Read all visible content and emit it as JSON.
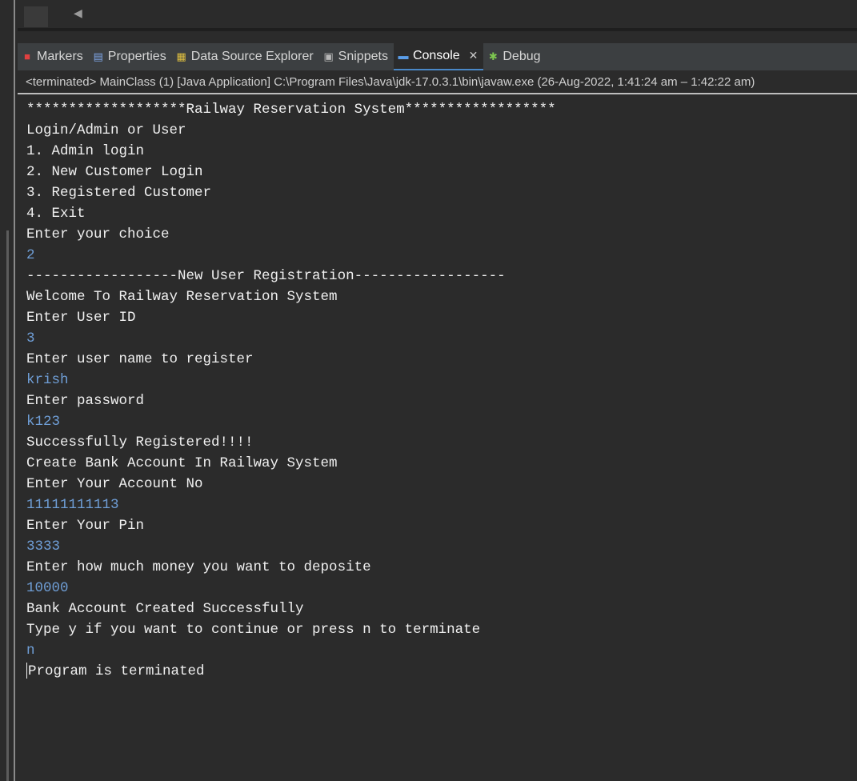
{
  "tabs": [
    {
      "id": "markers",
      "label": "Markers",
      "icon": "markers-icon",
      "color": "#e04040"
    },
    {
      "id": "properties",
      "label": "Properties",
      "icon": "properties-icon",
      "color": "#7fa7e8"
    },
    {
      "id": "datasource",
      "label": "Data Source Explorer",
      "icon": "data-source-icon",
      "color": "#e0c040"
    },
    {
      "id": "snippets",
      "label": "Snippets",
      "icon": "snippets-icon",
      "color": "#b8b8b8"
    },
    {
      "id": "console",
      "label": "Console",
      "icon": "console-icon",
      "color": "#5a9de8",
      "active": true,
      "close": "✕"
    },
    {
      "id": "debug",
      "label": "Debug",
      "icon": "debug-icon",
      "color": "#7ec850"
    }
  ],
  "status": "<terminated> MainClass (1) [Java Application] C:\\Program Files\\Java\\jdk-17.0.3.1\\bin\\javaw.exe  (26-Aug-2022, 1:41:24 am – 1:42:22 am)",
  "console_lines": [
    {
      "text": "*******************Railway Reservation System******************",
      "type": "output"
    },
    {
      "text": "Login/Admin or User",
      "type": "output"
    },
    {
      "text": "1. Admin login",
      "type": "output"
    },
    {
      "text": "2. New Customer Login",
      "type": "output"
    },
    {
      "text": "3. Registered Customer",
      "type": "output"
    },
    {
      "text": "4. Exit",
      "type": "output"
    },
    {
      "text": "Enter your choice",
      "type": "output"
    },
    {
      "text": "2",
      "type": "input"
    },
    {
      "text": "------------------New User Registration------------------",
      "type": "output"
    },
    {
      "text": "Welcome To Railway Reservation System",
      "type": "output"
    },
    {
      "text": "Enter User ID",
      "type": "output"
    },
    {
      "text": "3",
      "type": "input"
    },
    {
      "text": "Enter user name to register",
      "type": "output"
    },
    {
      "text": "krish",
      "type": "input"
    },
    {
      "text": "Enter password",
      "type": "output"
    },
    {
      "text": "k123",
      "type": "input"
    },
    {
      "text": "Successfully Registered!!!!",
      "type": "output"
    },
    {
      "text": "Create Bank Account In Railway System",
      "type": "output"
    },
    {
      "text": "Enter Your Account No",
      "type": "output"
    },
    {
      "text": "11111111113",
      "type": "input"
    },
    {
      "text": "Enter Your Pin",
      "type": "output"
    },
    {
      "text": "3333",
      "type": "input"
    },
    {
      "text": "Enter how much money you want to deposite",
      "type": "output"
    },
    {
      "text": "10000",
      "type": "input"
    },
    {
      "text": "Bank Account Created Successfully",
      "type": "output"
    },
    {
      "text": "Type y if you want to continue or press n to terminate",
      "type": "output"
    },
    {
      "text": "n",
      "type": "input"
    },
    {
      "text": "Program is terminated",
      "type": "output",
      "cursor": true
    }
  ],
  "colors": {
    "background": "#2b2b2b",
    "tabbar": "#3c3f41",
    "output_text": "#f0f0f0",
    "input_text": "#6f9ed6",
    "active_tab_underline": "#4a88c7"
  }
}
